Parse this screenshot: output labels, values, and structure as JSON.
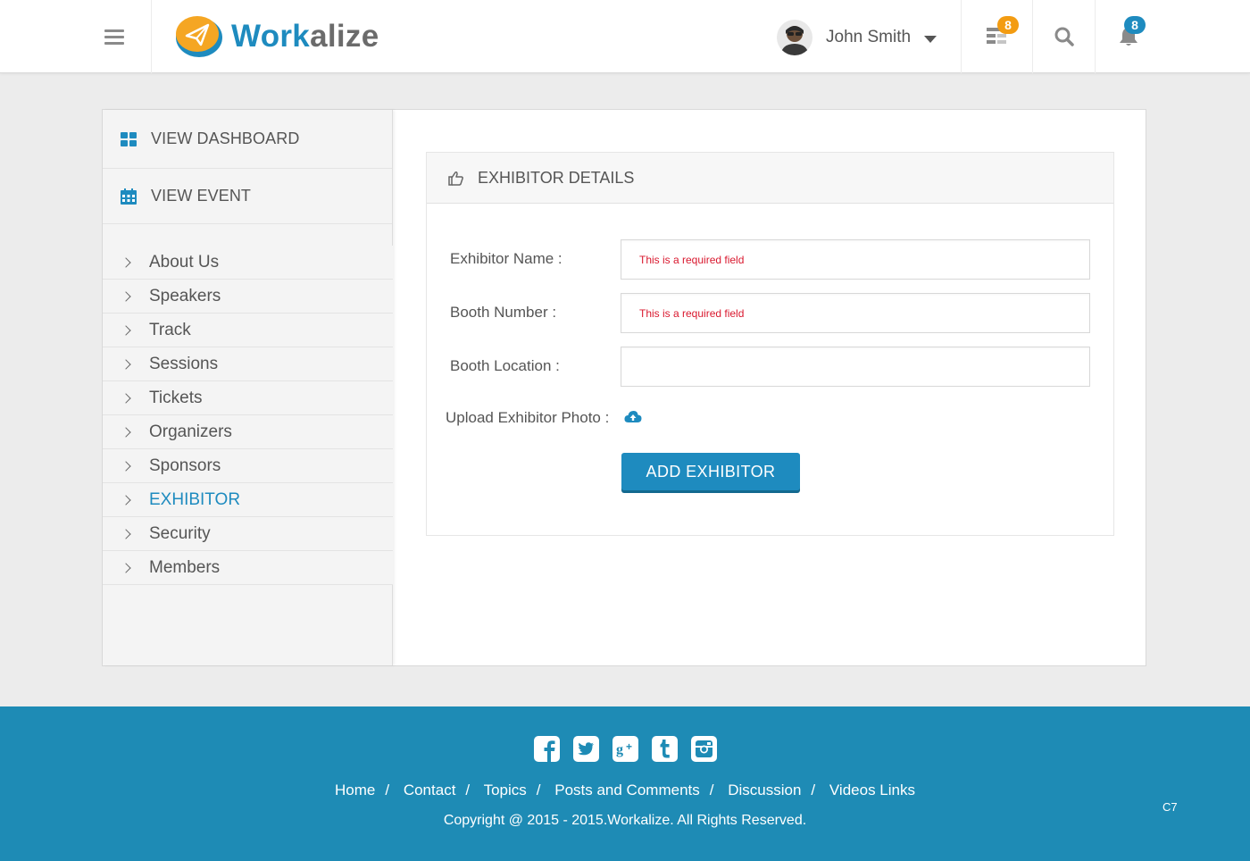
{
  "header": {
    "logo_part1": "Work",
    "logo_part2": "alize",
    "user_name": "John Smith",
    "tasks_badge": "8",
    "notifications_badge": "8"
  },
  "sidebar": {
    "top_items": [
      {
        "label": "VIEW DASHBOARD",
        "icon": "dashboard-icon"
      },
      {
        "label": "VIEW EVENT",
        "icon": "calendar-icon"
      }
    ],
    "nav_items": [
      {
        "label": "About Us"
      },
      {
        "label": "Speakers"
      },
      {
        "label": "Track"
      },
      {
        "label": "Sessions"
      },
      {
        "label": "Tickets"
      },
      {
        "label": "Organizers"
      },
      {
        "label": "Sponsors"
      },
      {
        "label": "EXHIBITOR",
        "active": true
      },
      {
        "label": "Security"
      },
      {
        "label": "Members"
      }
    ]
  },
  "form": {
    "title": "EXHIBITOR DETAILS",
    "fields": [
      {
        "label": "Exhibitor Name :",
        "error": "This is a required field",
        "value": ""
      },
      {
        "label": "Booth Number :",
        "error": "This is a required field",
        "value": ""
      },
      {
        "label": "Booth Location :",
        "error": "",
        "value": ""
      }
    ],
    "upload_label": "Upload Exhibitor Photo :",
    "submit_label": "ADD EXHIBITOR"
  },
  "footer": {
    "social": [
      "facebook-icon",
      "twitter-icon",
      "google-plus-icon",
      "tumblr-icon",
      "instagram-icon"
    ],
    "links": [
      "Home",
      "Contact",
      "Topics",
      "Posts and Comments",
      "Discussion",
      "Videos Links"
    ],
    "copyright": "Copyright @ 2015 - 2015.Workalize. All Rights Reserved.",
    "code": "C7"
  },
  "colors": {
    "accent": "#1e8bbf",
    "footer_bg": "#1e8bb5",
    "badge_orange": "#f39c12",
    "error_red": "#d9182e"
  }
}
